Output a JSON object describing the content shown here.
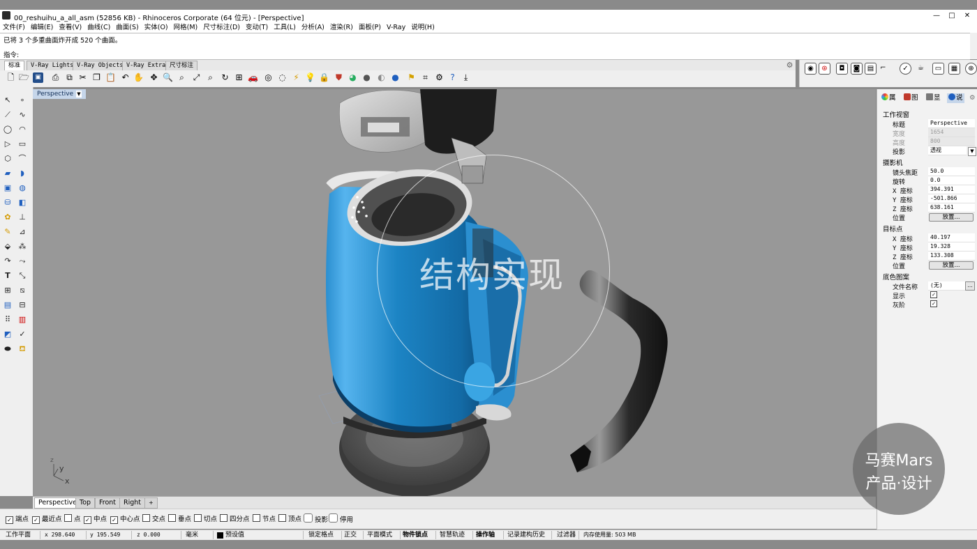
{
  "window": {
    "title": "00_reshuihu_a_all_asm (52856 KB) - Rhinoceros Corporate (64 位元) - [Perspective]",
    "min": "—",
    "max": "□",
    "close": "✕"
  },
  "menu": [
    "文件(F)",
    "编辑(E)",
    "查看(V)",
    "曲线(C)",
    "曲面(S)",
    "实体(O)",
    "网格(M)",
    "尺寸标注(D)",
    "变动(T)",
    "工具(L)",
    "分析(A)",
    "渲染(R)",
    "面板(P)",
    "V-Ray",
    "说明(H)"
  ],
  "command": {
    "history": "已将 3 个多重曲面炸开成 520 个曲面。",
    "prompt": "指令:"
  },
  "toolbar_tabs": [
    "标准",
    "V-Ray Lights",
    "V-Ray Objects",
    "V-Ray Extra",
    "尺寸标注"
  ],
  "viewport": {
    "label": "Perspective",
    "axis_y": "y",
    "axis_x": "x",
    "axis_z": "z",
    "tabs": [
      "Perspective",
      "Top",
      "Front",
      "Right"
    ],
    "add_tab": "+"
  },
  "panel": {
    "tabs": [
      "属",
      "图",
      "显",
      "说"
    ],
    "section_viewport": "工作视窗",
    "rows_viewport": [
      {
        "label": "标题",
        "value": "Perspective"
      },
      {
        "label": "宽度",
        "value": "1654"
      },
      {
        "label": "高度",
        "value": "800"
      },
      {
        "label": "投影",
        "value": "透视"
      }
    ],
    "section_camera": "摄影机",
    "rows_camera": [
      {
        "label": "镜头焦距",
        "value": "50.0"
      },
      {
        "label": "旋转",
        "value": "0.0"
      },
      {
        "label": "X 座标",
        "value": "394.391"
      },
      {
        "label": "Y 座标",
        "value": "-501.866"
      },
      {
        "label": "Z 座标",
        "value": "638.161"
      },
      {
        "label": "位置",
        "value": "放置..."
      }
    ],
    "section_target": "目标点",
    "rows_target": [
      {
        "label": "X 座标",
        "value": "40.197"
      },
      {
        "label": "Y 座标",
        "value": "19.328"
      },
      {
        "label": "Z 座标",
        "value": "133.308"
      },
      {
        "label": "位置",
        "value": "放置..."
      }
    ],
    "section_bg": "底色图案",
    "rows_bg": [
      {
        "label": "文件名称",
        "value": "(无)"
      },
      {
        "label": "显示",
        "value": "✓"
      },
      {
        "label": "灰阶",
        "value": "✓"
      }
    ],
    "browse": "..."
  },
  "osnap": [
    {
      "label": "端点",
      "checked": true
    },
    {
      "label": "最近点",
      "checked": true
    },
    {
      "label": "点",
      "checked": false
    },
    {
      "label": "中点",
      "checked": true
    },
    {
      "label": "中心点",
      "checked": true
    },
    {
      "label": "交点",
      "checked": false
    },
    {
      "label": "垂点",
      "checked": false
    },
    {
      "label": "切点",
      "checked": false
    },
    {
      "label": "四分点",
      "checked": false
    },
    {
      "label": "节点",
      "checked": false
    },
    {
      "label": "顶点",
      "checked": false
    },
    {
      "label": "投影",
      "checked": false
    },
    {
      "label": "停用",
      "checked": false
    }
  ],
  "status": {
    "cplane": "工作平面",
    "x": "x 298.640",
    "y": "y 195.549",
    "z": "z 0.000",
    "units": "毫米",
    "layer": "预设值",
    "grid_snap": "锁定格点",
    "ortho": "正交",
    "planar": "平面模式",
    "osnap": "物件锁点",
    "smarttrack": "智慧轨迹",
    "gumball": "操作轴",
    "history": "记录建构历史",
    "filter": "过滤器",
    "memory": "内存使用量: 503 MB"
  },
  "watermark": "结构实现",
  "brand": {
    "line1": "马赛Mars",
    "line2": "产品·设计"
  },
  "colors": {
    "kettle_blue": "#1f86c6",
    "accent": "#c6d6ea"
  }
}
